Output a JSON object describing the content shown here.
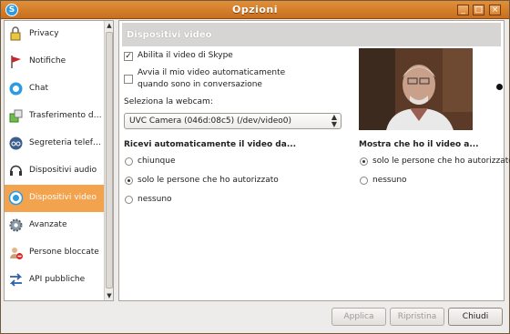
{
  "window": {
    "title": "Opzioni"
  },
  "sidebar": {
    "items": [
      {
        "label": "Privacy",
        "icon": "privacy-icon"
      },
      {
        "label": "Notifiche",
        "icon": "flag-icon"
      },
      {
        "label": "Chat",
        "icon": "chat-icon"
      },
      {
        "label": "Trasferimento di ...",
        "icon": "file-transfer-icon"
      },
      {
        "label": "Segreteria telefo...",
        "icon": "voicemail-icon"
      },
      {
        "label": "Dispositivi audio",
        "icon": "audio-devices-icon"
      },
      {
        "label": "Dispositivi video",
        "icon": "video-devices-icon"
      },
      {
        "label": "Avanzate",
        "icon": "gear-icon"
      },
      {
        "label": "Persone bloccate",
        "icon": "blocked-users-icon"
      },
      {
        "label": "API pubbliche",
        "icon": "api-arrows-icon"
      }
    ],
    "active_index": 6
  },
  "panel": {
    "header": "Dispositivi video",
    "enable_video_label": "Abilita il video di Skype",
    "enable_video_checked": true,
    "autostart_label_1": "Avvia il mio video automaticamente",
    "autostart_label_2": "quando sono in conversazione",
    "autostart_checked": false,
    "webcam_label": "Seleziona la webcam:",
    "webcam_value": "UVC Camera (046d:08c5) (/dev/video0)",
    "receive": {
      "title": "Ricevi automaticamente il video da...",
      "options": [
        "chiunque",
        "solo le persone che ho autorizzato",
        "nessuno"
      ],
      "selected": 1
    },
    "show": {
      "title": "Mostra che ho il video a...",
      "options": [
        "solo le persone che ho autorizzato",
        "nessuno"
      ],
      "selected": 0
    }
  },
  "footer": {
    "apply": "Applica",
    "reset": "Ripristina",
    "close": "Chiudi"
  },
  "colors": {
    "titlebar": "#d9822f",
    "active_item": "#f3a24d",
    "header_bg": "#d6d5d3"
  }
}
